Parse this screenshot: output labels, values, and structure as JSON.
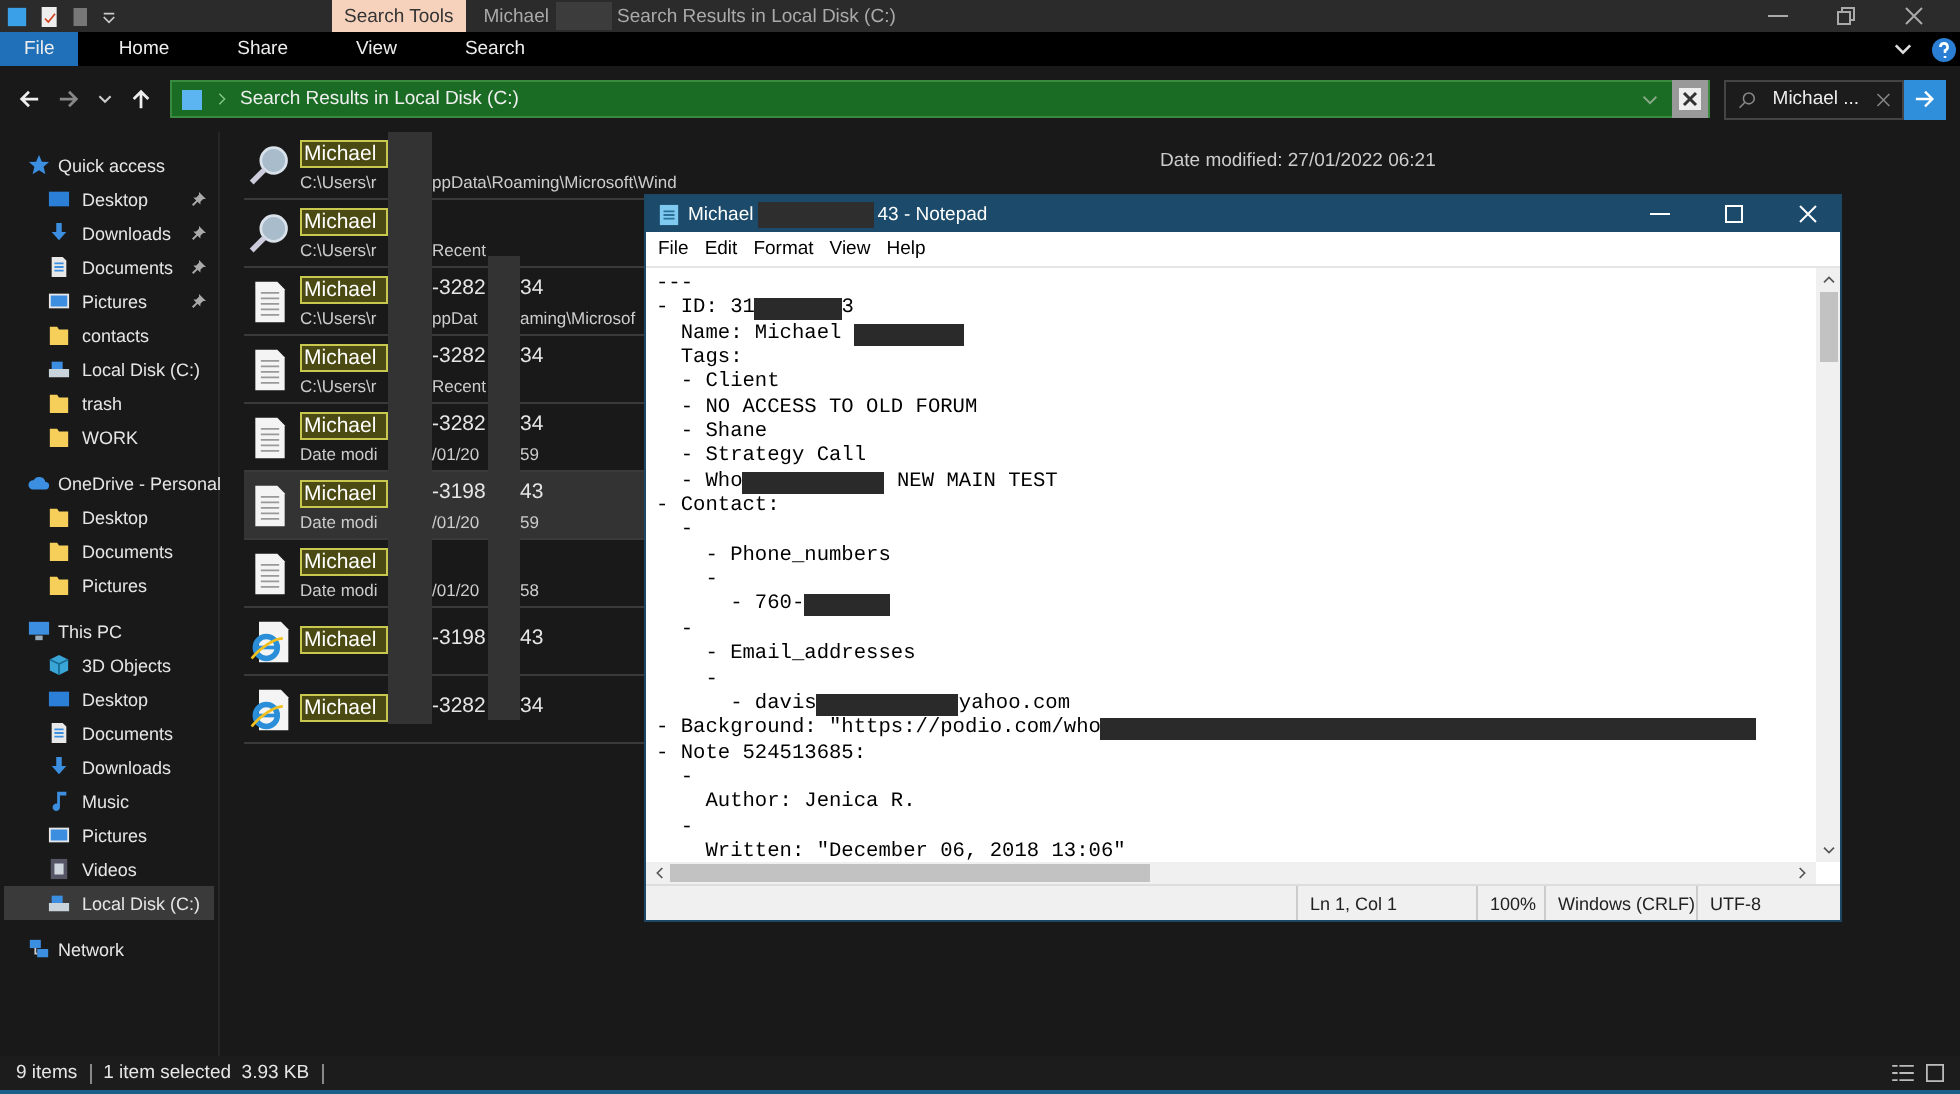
{
  "explorer": {
    "title_bar": {
      "context_tab": "Search Tools",
      "title_start": "Michael",
      "title_end": "Search Results in Local Disk (C:)"
    },
    "ribbon_tabs": [
      {
        "label": "File",
        "selected": true
      },
      {
        "label": "Home",
        "selected": false
      },
      {
        "label": "Share",
        "selected": false
      },
      {
        "label": "View",
        "selected": false
      },
      {
        "label": "Search",
        "selected": false
      }
    ],
    "address": "Search Results in Local Disk (C:)",
    "search": {
      "value": "Michael ..."
    },
    "sidebar": [
      {
        "label": "Quick access",
        "kind": "star",
        "selected": false,
        "children": [
          {
            "label": "Desktop",
            "kind": "desktop",
            "pinned": true,
            "selected": false
          },
          {
            "label": "Downloads",
            "kind": "download",
            "pinned": true,
            "selected": false
          },
          {
            "label": "Documents",
            "kind": "document",
            "pinned": true,
            "selected": false
          },
          {
            "label": "Pictures",
            "kind": "pictures",
            "pinned": true,
            "selected": false
          },
          {
            "label": "contacts",
            "kind": "folder",
            "pinned": false,
            "selected": false
          },
          {
            "label": "Local Disk (C:)",
            "kind": "drive",
            "pinned": false,
            "selected": false
          },
          {
            "label": "trash",
            "kind": "folder",
            "pinned": false,
            "selected": false
          },
          {
            "label": "WORK",
            "kind": "folder",
            "pinned": false,
            "selected": false
          }
        ]
      },
      {
        "label": "OneDrive - Personal",
        "kind": "cloud",
        "selected": false,
        "children": [
          {
            "label": "Desktop",
            "kind": "folder",
            "selected": false
          },
          {
            "label": "Documents",
            "kind": "folder",
            "selected": false
          },
          {
            "label": "Pictures",
            "kind": "folder",
            "selected": false
          }
        ]
      },
      {
        "label": "This PC",
        "kind": "pc",
        "selected": false,
        "children": [
          {
            "label": "3D Objects",
            "kind": "cube",
            "selected": false
          },
          {
            "label": "Desktop",
            "kind": "desktop",
            "selected": false
          },
          {
            "label": "Documents",
            "kind": "document",
            "selected": false
          },
          {
            "label": "Downloads",
            "kind": "download",
            "selected": false
          },
          {
            "label": "Music",
            "kind": "music",
            "selected": false
          },
          {
            "label": "Pictures",
            "kind": "pictures",
            "selected": false
          },
          {
            "label": "Videos",
            "kind": "video",
            "selected": false
          },
          {
            "label": "Local Disk (C:)",
            "kind": "drive",
            "selected": true
          }
        ]
      },
      {
        "label": "Network",
        "kind": "network",
        "selected": false
      }
    ],
    "results": [
      {
        "kind": "search",
        "selected": false,
        "name": [
          "Michael"
        ],
        "detail": [
          "C:\\Users\\r",
          "ppData\\Roaming\\Microsoft\\Wind"
        ]
      },
      {
        "kind": "search",
        "selected": false,
        "name": [
          "Michael"
        ],
        "detail": [
          "C:\\Users\\r",
          "Recent"
        ]
      },
      {
        "kind": "text",
        "selected": false,
        "name": [
          "Michael",
          "-3282",
          "34"
        ],
        "detail": [
          "C:\\Users\\r",
          "ppDat",
          "aming\\Microsof"
        ]
      },
      {
        "kind": "text",
        "selected": false,
        "name": [
          "Michael",
          "-3282",
          "34"
        ],
        "detail": [
          "C:\\Users\\r",
          "Recent"
        ]
      },
      {
        "kind": "text",
        "selected": false,
        "name": [
          "Michael",
          "-3282",
          "34"
        ],
        "detail": [
          "Date modi",
          "/01/20",
          "59"
        ]
      },
      {
        "kind": "text",
        "selected": true,
        "name": [
          "Michael",
          "-3198",
          "43"
        ],
        "detail": [
          "Date modi",
          "/01/20",
          "59"
        ]
      },
      {
        "kind": "text",
        "selected": false,
        "name": [
          "Michael"
        ],
        "detail": [
          "Date modi",
          "/01/20",
          "58"
        ]
      },
      {
        "kind": "browser",
        "selected": false,
        "name": [
          "Michael",
          "-3198",
          "43"
        ]
      },
      {
        "kind": "browser",
        "selected": false,
        "name": [
          "Michael",
          "-3282",
          "34"
        ]
      }
    ],
    "details": "Date modified: 27/01/2022 06:21",
    "status": [
      "9 items",
      "1 item selected  3.93 KB"
    ]
  },
  "notepad": {
    "title_start": "Michael",
    "title_end": "43 - Notepad",
    "menu": [
      "File",
      "Edit",
      "Format",
      "View",
      "Help"
    ],
    "lines": [
      {
        "text": "---"
      },
      {
        "text": "- ID: 31",
        "redacted": true,
        "after": "3"
      },
      {
        "text": "  Name: Michael ",
        "redacted": true
      },
      {
        "text": "  Tags:"
      },
      {
        "text": "  - Client"
      },
      {
        "text": "  - NO ACCESS TO OLD FORUM"
      },
      {
        "text": "  - Shane"
      },
      {
        "text": "  - Strategy Call"
      },
      {
        "text": "  - Who",
        "redacted": true,
        "after": " NEW MAIN TEST"
      },
      {
        "text": "- Contact:"
      },
      {
        "text": "  -"
      },
      {
        "text": "    - Phone_numbers"
      },
      {
        "text": "    -"
      },
      {
        "text": "      - 760-",
        "redacted": true
      },
      {
        "text": "  -"
      },
      {
        "text": "    - Email_addresses"
      },
      {
        "text": "    -"
      },
      {
        "text": "      - davis",
        "redacted": true,
        "after": "yahoo.com"
      },
      {
        "text": "- Background: \"https://podio.com/who",
        "redacted": true
      },
      {
        "text": "- Note 524513685:"
      },
      {
        "text": "  -"
      },
      {
        "text": "    Author: Jenica R."
      },
      {
        "text": "  -"
      },
      {
        "text": "    Written: \"December 06, 2018 13:06\""
      }
    ],
    "status": [
      "Ln 1, Col 1",
      "100%",
      "Windows (CRLF)",
      "UTF-8"
    ]
  }
}
